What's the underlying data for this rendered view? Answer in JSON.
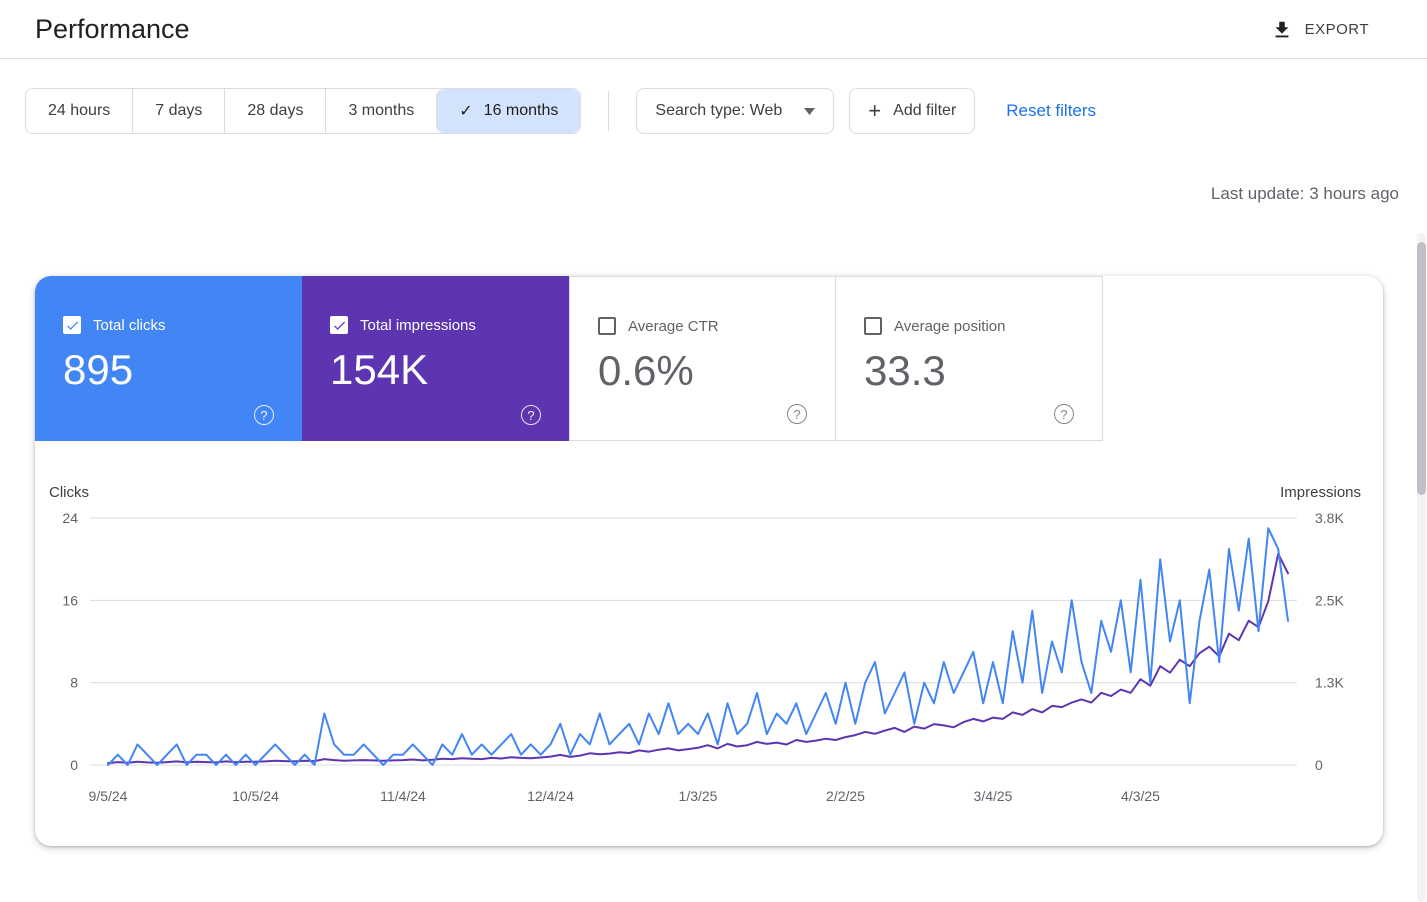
{
  "header": {
    "title": "Performance",
    "export_label": "EXPORT"
  },
  "toolbar": {
    "date_ranges": [
      "24 hours",
      "7 days",
      "28 days",
      "3 months",
      "16 months"
    ],
    "selected_range_index": 4,
    "search_type_label": "Search type: Web",
    "add_filter_label": "Add filter",
    "reset_filters_label": "Reset filters"
  },
  "status": {
    "last_update": "Last update: 3 hours ago"
  },
  "metrics": [
    {
      "label": "Total clicks",
      "value": "895",
      "checked": true,
      "color": "#4285f4"
    },
    {
      "label": "Total impressions",
      "value": "154K",
      "checked": true,
      "color": "#5e35b1"
    },
    {
      "label": "Average CTR",
      "value": "0.6%",
      "checked": false
    },
    {
      "label": "Average position",
      "value": "33.3",
      "checked": false
    }
  ],
  "chart_data": {
    "type": "line",
    "title": "",
    "grid": "horizontal",
    "legend_position": "none",
    "left_axis": {
      "label": "Clicks",
      "ticks": [
        0,
        8,
        16,
        24
      ],
      "tick_labels": [
        "0",
        "8",
        "16",
        "24"
      ],
      "max": 24
    },
    "right_axis": {
      "label": "Impressions",
      "ticks": [
        0,
        1267,
        2533,
        3800
      ],
      "tick_labels": [
        "0",
        "1.3K",
        "2.5K",
        "3.8K"
      ],
      "max": 3800
    },
    "x_tick_labels": [
      "9/5/24",
      "10/5/24",
      "11/4/24",
      "12/4/24",
      "1/3/25",
      "2/2/25",
      "3/4/25",
      "4/3/25"
    ],
    "x_tick_positions": [
      0,
      0.125,
      0.25,
      0.375,
      0.5,
      0.625,
      0.75,
      0.875
    ],
    "series": [
      {
        "name": "Clicks",
        "axis": "left",
        "color": "#4285f4",
        "values": [
          0,
          1,
          0,
          2,
          1,
          0,
          1,
          2,
          0,
          1,
          1,
          0,
          1,
          0,
          1,
          0,
          1,
          2,
          1,
          0,
          1,
          0,
          5,
          2,
          1,
          1,
          2,
          1,
          0,
          1,
          1,
          2,
          1,
          0,
          2,
          1,
          3,
          1,
          2,
          1,
          2,
          3,
          1,
          2,
          1,
          2,
          4,
          1,
          3,
          2,
          5,
          2,
          3,
          4,
          2,
          5,
          3,
          6,
          3,
          4,
          3,
          5,
          2,
          6,
          3,
          4,
          7,
          3,
          5,
          4,
          6,
          3,
          5,
          7,
          4,
          8,
          4,
          8,
          10,
          5,
          7,
          9,
          4,
          8,
          6,
          10,
          7,
          9,
          11,
          6,
          10,
          6,
          13,
          8,
          15,
          7,
          12,
          9,
          16,
          10,
          7,
          14,
          11,
          16,
          9,
          18,
          8,
          20,
          12,
          16,
          6,
          14,
          19,
          10,
          21,
          15,
          22,
          13,
          23,
          21,
          14
        ]
      },
      {
        "name": "Impressions",
        "axis": "right",
        "color": "#5e35b1",
        "values": [
          30,
          45,
          35,
          50,
          40,
          35,
          45,
          55,
          40,
          50,
          45,
          40,
          55,
          45,
          50,
          50,
          55,
          65,
          60,
          55,
          65,
          60,
          90,
          75,
          65,
          70,
          75,
          70,
          65,
          70,
          75,
          85,
          70,
          80,
          95,
          90,
          105,
          95,
          90,
          110,
          100,
          120,
          110,
          105,
          115,
          130,
          155,
          125,
          145,
          180,
          165,
          175,
          195,
          185,
          225,
          205,
          235,
          255,
          225,
          245,
          265,
          305,
          255,
          325,
          285,
          305,
          355,
          325,
          345,
          315,
          385,
          355,
          375,
          405,
          385,
          430,
          460,
          510,
          480,
          530,
          570,
          510,
          590,
          560,
          630,
          610,
          580,
          660,
          710,
          670,
          730,
          710,
          810,
          770,
          860,
          810,
          910,
          890,
          960,
          1010,
          960,
          1110,
          1060,
          1160,
          1110,
          1320,
          1220,
          1520,
          1420,
          1620,
          1520,
          1720,
          1820,
          1670,
          2020,
          1920,
          2220,
          2120,
          2520,
          3250,
          2950
        ]
      }
    ]
  }
}
